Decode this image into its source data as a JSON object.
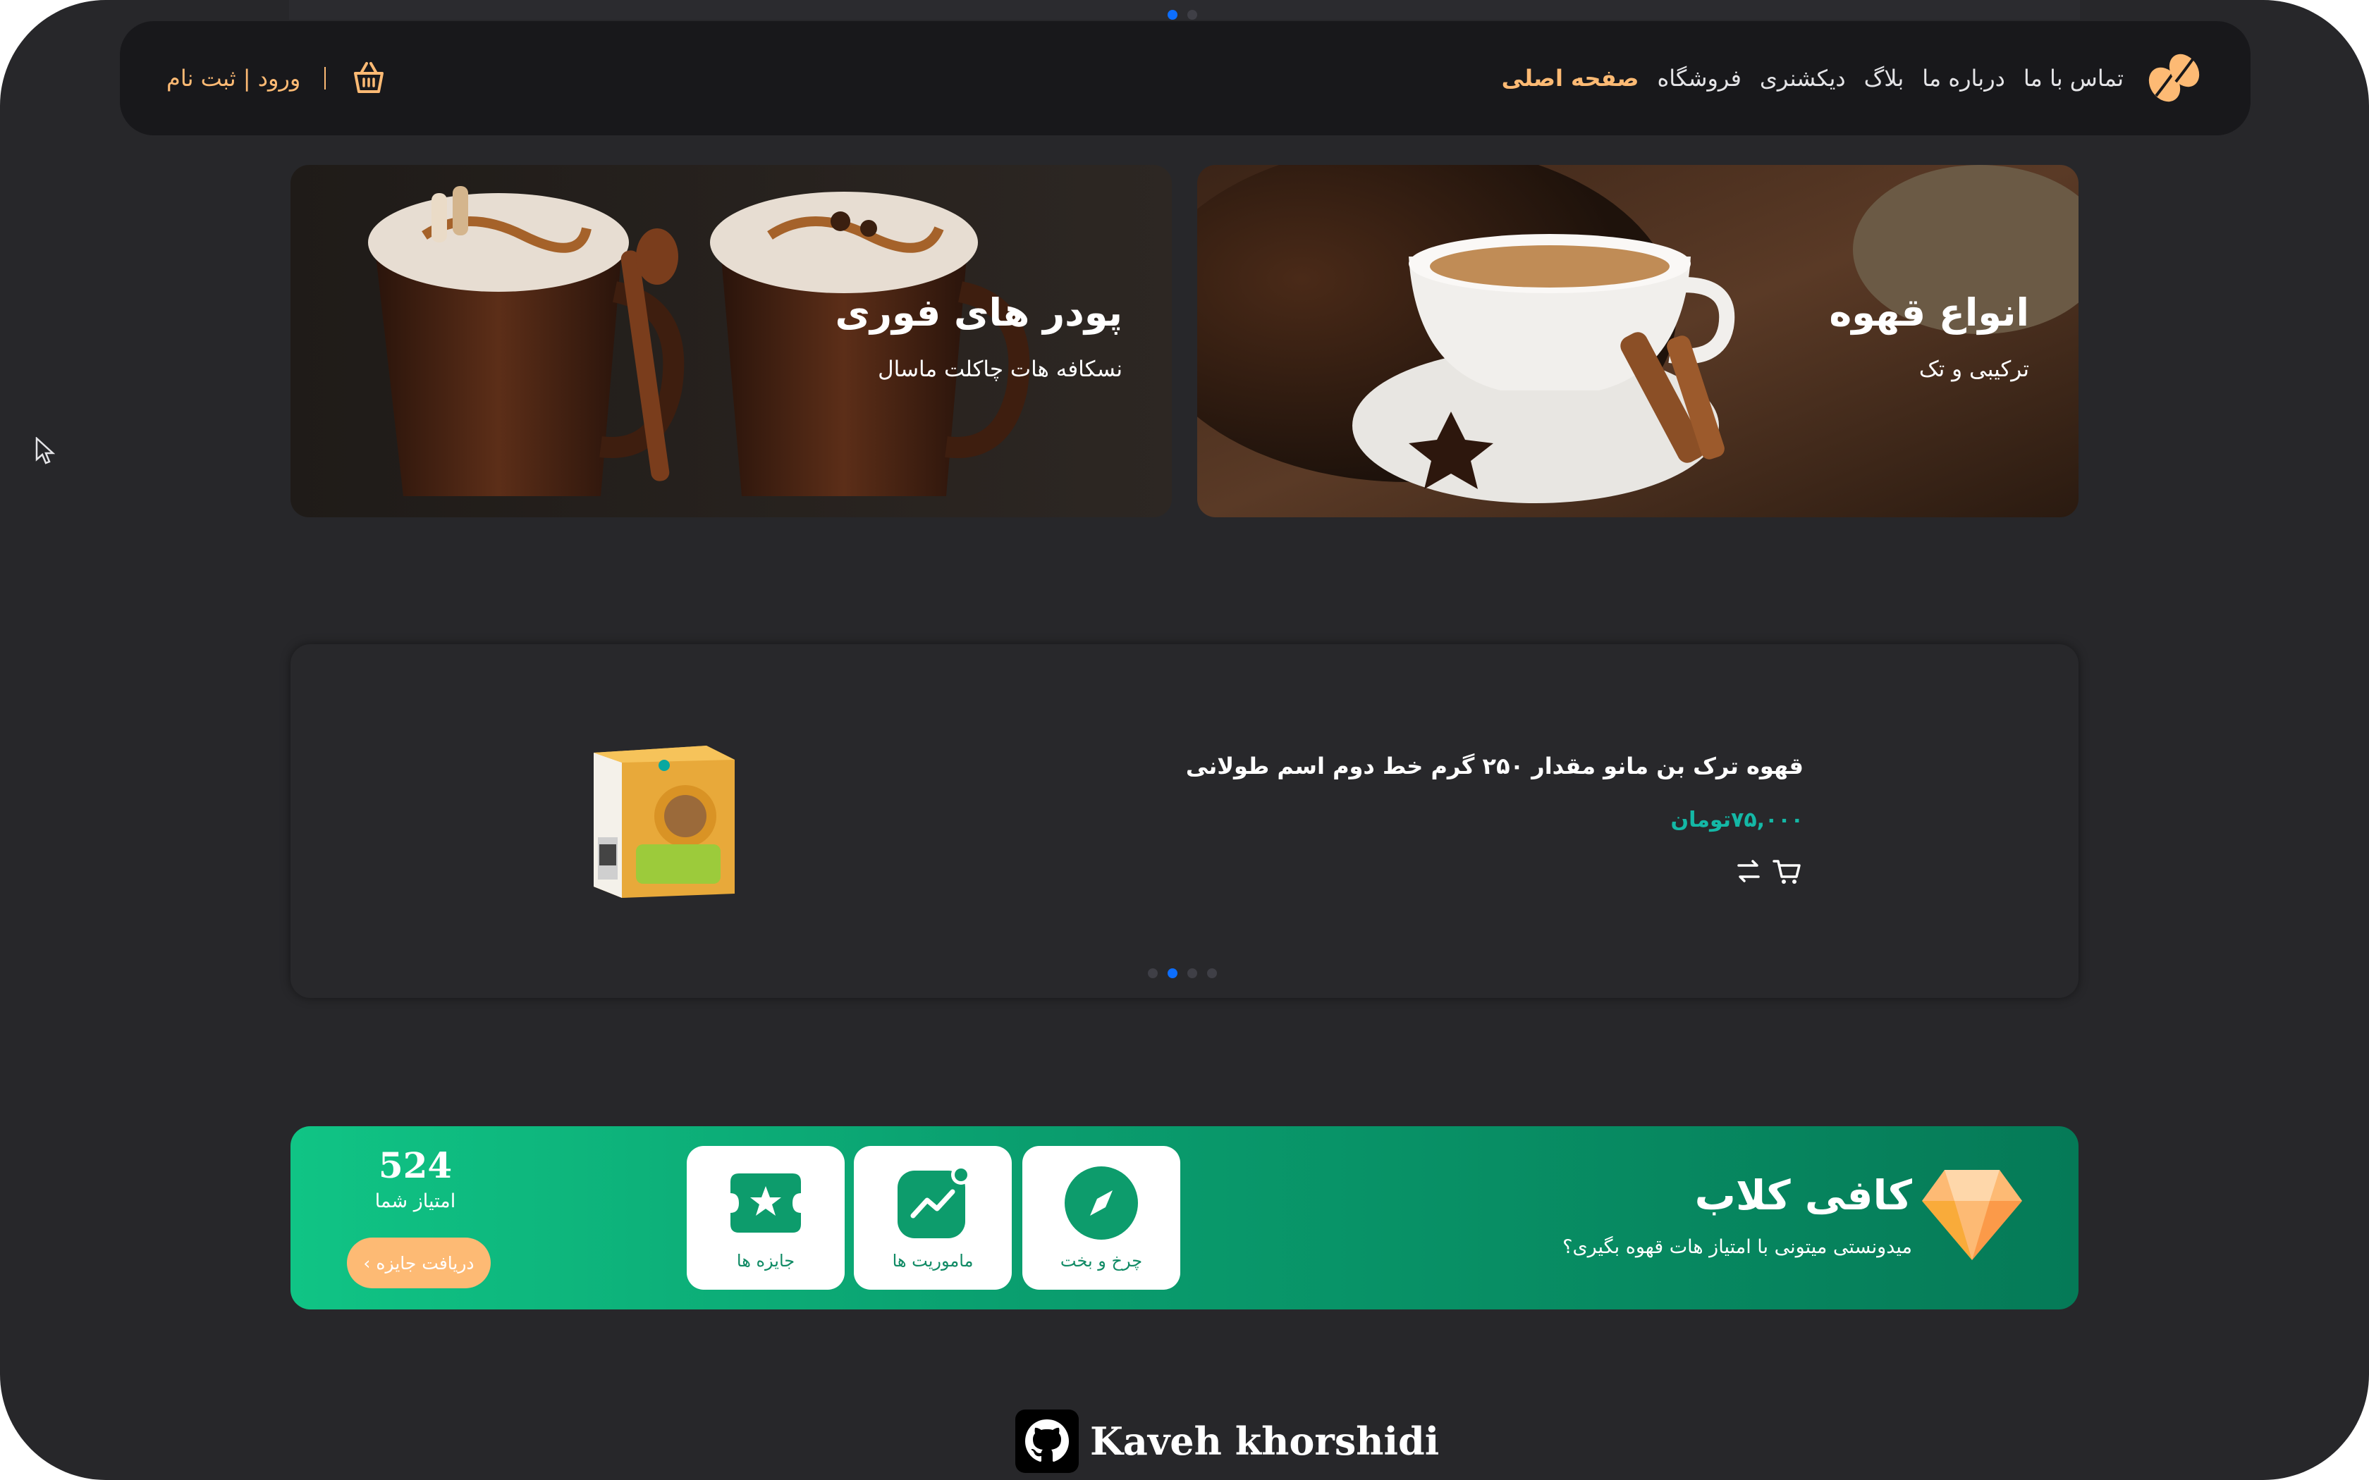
{
  "nav": {
    "links": [
      "صفحه اصلی",
      "فروشگاه",
      "دیکشنری",
      "بلاگ",
      "درباره ما",
      "تماس با ما"
    ],
    "auth_label": "ورود | ثبت نام"
  },
  "banners": [
    {
      "title": "انواع قهوه",
      "subtitle": "ترکیبی و تک"
    },
    {
      "title": "پودر های فوری",
      "subtitle": "نسکافه هات چاکلت ماسال"
    }
  ],
  "product": {
    "name": "قهوه ترک بن مانو مقدار ۲۵۰ گرم خط دوم اسم طولانی",
    "price": "۷۵,۰۰۰تومان",
    "slider_active_index": 1,
    "slider_count": 4
  },
  "club": {
    "title": "کافی کلاب",
    "subtitle": "میدونستی میتونی با امتیاز هات قهوه بگیری؟",
    "tiles": [
      "چرخ و بخت",
      "ماموریت ها",
      "جایزه ها"
    ],
    "points": "524",
    "points_label": "امتیاز شما",
    "reward_button": "دریافت جایزه"
  },
  "footer": {
    "name": "Kaveh khorshidi"
  },
  "colors": {
    "accent": "#fdba74",
    "price": "#14b8a6",
    "club_green": "#0a9f6f",
    "slider_active": "#0d6efd"
  },
  "icons": [
    "cursor-icon",
    "coffee-beans-logo",
    "basket-icon",
    "cart-icon",
    "compare-icon",
    "diamond-icon",
    "compass-icon",
    "chart-icon",
    "star-ticket-icon",
    "github-icon"
  ]
}
